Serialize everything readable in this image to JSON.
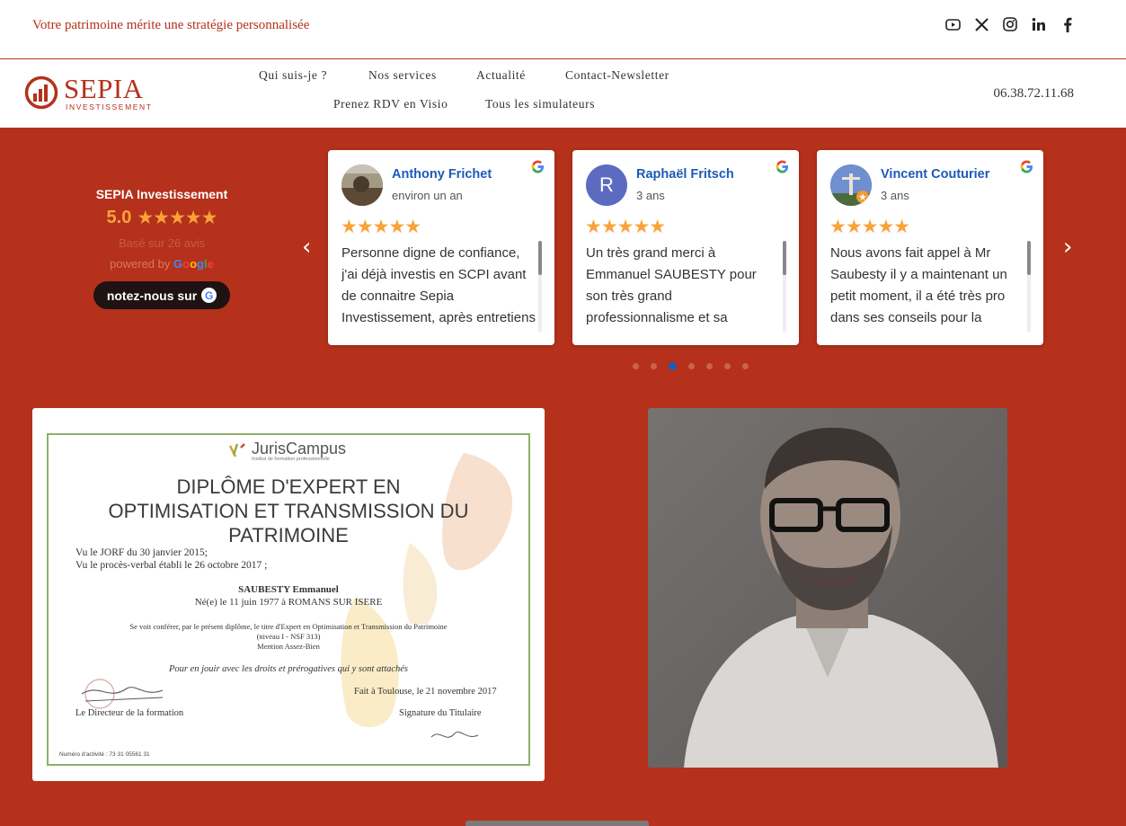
{
  "topbar": {
    "tagline": "Votre patrimoine mérite une stratégie personnalisée",
    "socials": [
      "youtube-icon",
      "x-icon",
      "instagram-icon",
      "linkedin-icon",
      "facebook-icon"
    ]
  },
  "header": {
    "logo_name": "SEPIA",
    "logo_sub": "INVESTISSEMENT",
    "nav": {
      "qui": "Qui suis-je ?",
      "services": "Nos services",
      "actualite": "Actualité",
      "contact": "Contact-Newsletter",
      "rdv": "Prenez RDV en Visio",
      "simulateurs": "Tous les simulateurs"
    },
    "phone": "06.38.72.11.68"
  },
  "reviews_summary": {
    "name": "SEPIA Investissement",
    "score": "5.0",
    "stars": "★★★★★",
    "based_on": "Basé sur 26 avis",
    "powered_by": "powered by",
    "google_letters": [
      "G",
      "o",
      "o",
      "g",
      "l",
      "e"
    ],
    "cta": "notez-nous sur",
    "cta_icon": "G"
  },
  "reviews": [
    {
      "name": "Anthony Frichet",
      "when": "environ un an",
      "stars": "★★★★★",
      "text": "Personne digne de confiance, j'ai déjà investis en SCPI avant de connaitre Sepia Investissement, après entretiens"
    },
    {
      "name": "Raphaël Fritsch",
      "initial": "R",
      "when": "3 ans",
      "stars": "★★★★★",
      "text": "Un très grand merci à Emmanuel SAUBESTY pour son très grand professionnalisme et sa"
    },
    {
      "name": "Vincent Couturier",
      "when": "3 ans",
      "stars": "★★★★★",
      "text": "Nous avons fait appel à Mr Saubesty il y a maintenant un petit moment, il a été très pro dans ses conseils pour la"
    }
  ],
  "carousel": {
    "dots": 7,
    "active_dot": 3
  },
  "diploma": {
    "logo": "JurisCampus",
    "logo_sub": "Institut de formation professionnelle",
    "title_line1": "DIPLÔME D'EXPERT EN",
    "title_line2": "OPTIMISATION ET TRANSMISSION DU",
    "title_line3": "PATRIMOINE",
    "vu1": "Vu le JORF du  30 janvier 2015;",
    "vu2": "Vu le procès-verbal établi le 26 octobre 2017 ;",
    "holder": "SAUBESTY Emmanuel",
    "born": "Né(e) le 11 juin 1977 à ROMANS SUR ISERE",
    "confer": "Se voit conférer, par le présent diplôme, le titre d'Expert en Optimisation et Transmission du Patrimoine",
    "level": "(niveau I - NSF 313)",
    "mention": "Mention Assez-Bien",
    "rights": "Pour en jouir avec les droits et prérogatives qui y sont attachés",
    "place_date": "Fait à Toulouse, le 21 novembre 2017",
    "director": "Le Directeur de la formation",
    "signature": "Signature du Titulaire",
    "numero": "Numéro d'activité : 73 31 05561 31"
  },
  "colors": {
    "brand_red": "#b5311b",
    "star_orange": "#f7a33a",
    "link_blue": "#1c5bb8"
  }
}
